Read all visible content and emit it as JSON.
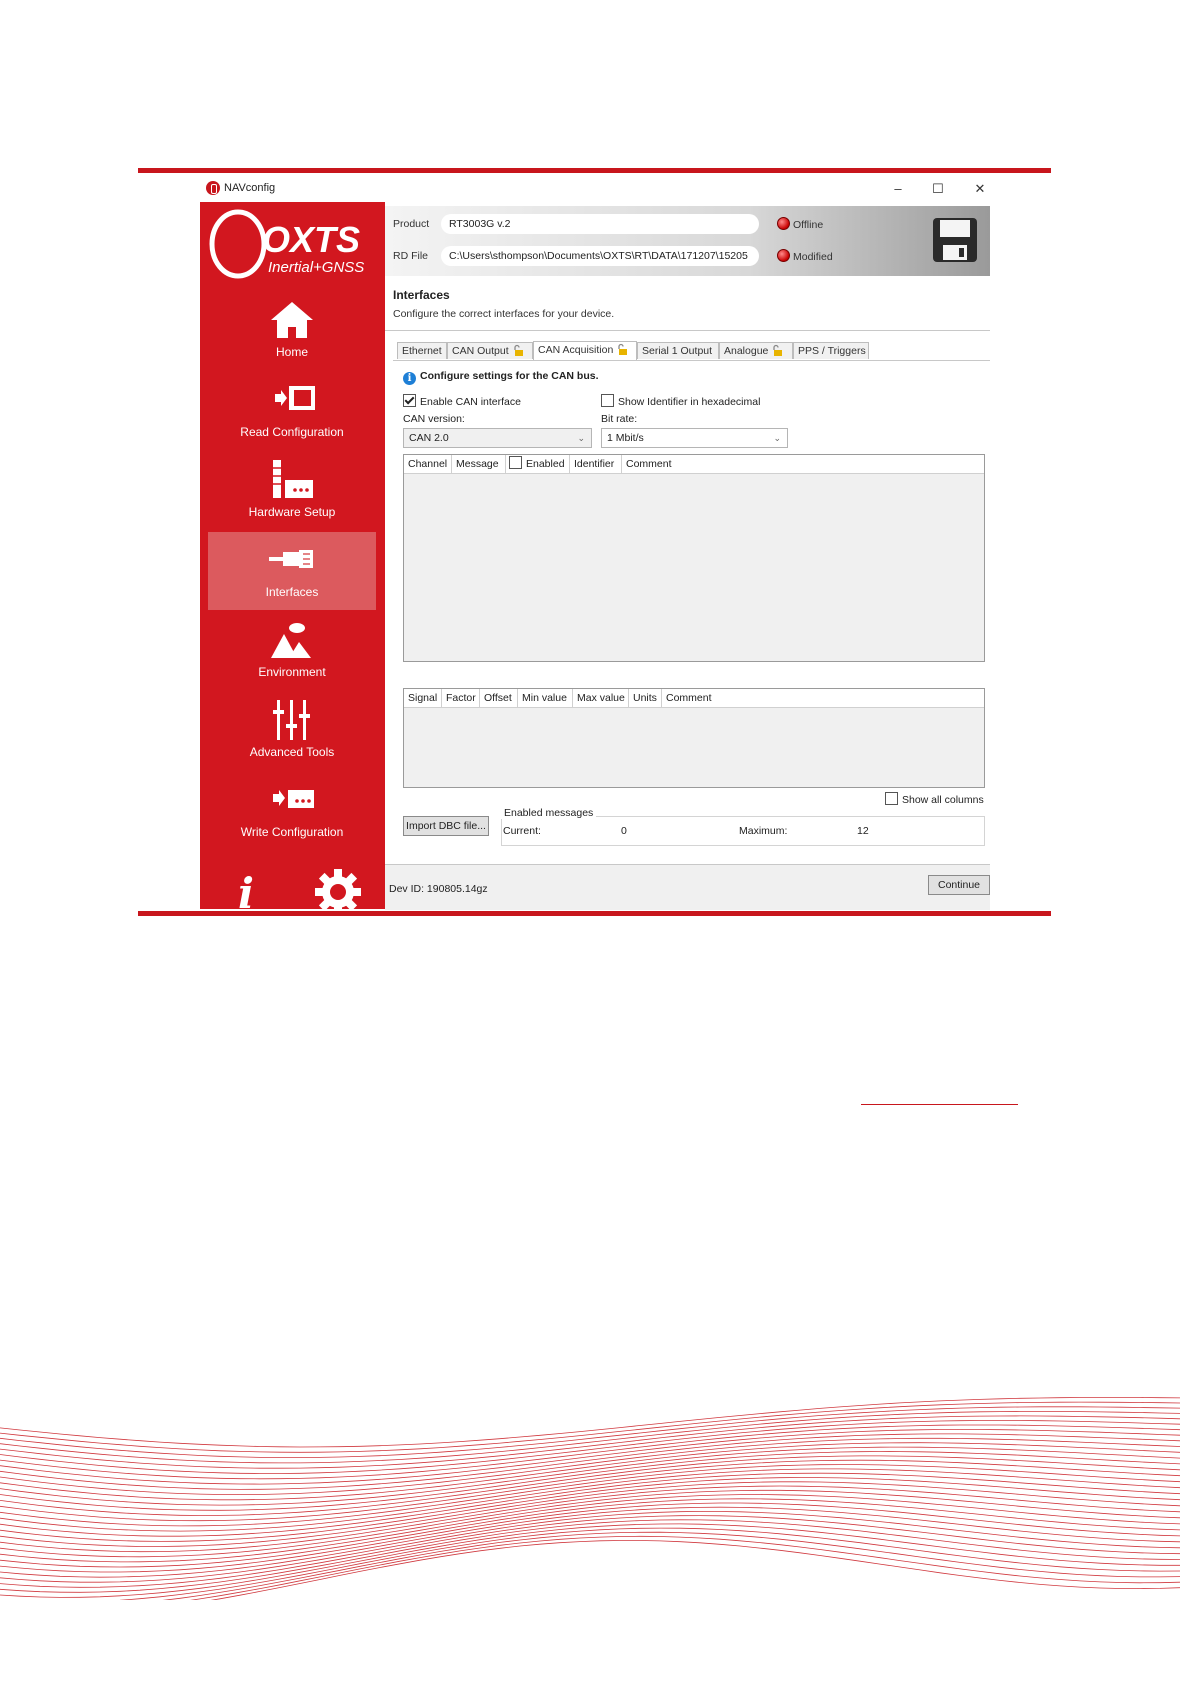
{
  "window": {
    "title": "NAVconfig",
    "controls": [
      "–",
      "☐",
      "✕"
    ]
  },
  "logo": {
    "brand": "OXTS",
    "tagline": "Inertial+GNSS"
  },
  "sidebar": {
    "items": [
      {
        "label": "Home",
        "icon": "home-icon"
      },
      {
        "label": "Read Configuration",
        "icon": "read-config-icon"
      },
      {
        "label": "Hardware Setup",
        "icon": "hardware-icon"
      },
      {
        "label": "Interfaces",
        "icon": "interfaces-icon",
        "active": true
      },
      {
        "label": "Environment",
        "icon": "environment-icon"
      },
      {
        "label": "Advanced Tools",
        "icon": "sliders-icon"
      },
      {
        "label": "Write Configuration",
        "icon": "write-config-icon"
      }
    ],
    "bottom": {
      "info_glyph": "i",
      "settings_icon": "gear-icon"
    }
  },
  "header": {
    "product_label": "Product",
    "product_value": "RT3003G v.2",
    "rd_label": "RD File",
    "rd_value": "C:\\Users\\sthompson\\Documents\\OXTS\\RT\\DATA\\171207\\15205",
    "status_offline": "Offline",
    "status_modified": "Modified"
  },
  "main": {
    "title": "Interfaces",
    "subtitle": "Configure the correct interfaces for your device.",
    "tabs": [
      {
        "label": "Ethernet"
      },
      {
        "label": "CAN Output",
        "locked": true
      },
      {
        "label": "CAN Acquisition",
        "locked": true,
        "active": true
      },
      {
        "label": "Serial 1 Output"
      },
      {
        "label": "Analogue",
        "locked": true
      },
      {
        "label": "PPS / Triggers"
      }
    ],
    "info_text": "Configure settings for the CAN bus.",
    "enable_can_label": "Enable CAN interface",
    "enable_can_checked": true,
    "show_hex_label": "Show Identifier in hexadecimal",
    "show_hex_checked": false,
    "can_version_label": "CAN version:",
    "can_version_value": "CAN 2.0",
    "bit_rate_label": "Bit rate:",
    "bit_rate_value": "1 Mbit/s",
    "channel_grid": {
      "columns": [
        "Channel",
        "Message",
        "Enabled",
        "Identifier",
        "Comment"
      ]
    },
    "signal_grid": {
      "columns": [
        "Signal",
        "Factor",
        "Offset",
        "Min value",
        "Max value",
        "Units",
        "Comment"
      ]
    },
    "show_all_columns_label": "Show all columns",
    "import_button": "Import DBC file...",
    "enabled_messages_label": "Enabled messages",
    "current_label": "Current:",
    "current_value": "0",
    "maximum_label": "Maximum:",
    "maximum_value": "12",
    "dev_id": "Dev ID: 190805.14gz",
    "continue_button": "Continue"
  },
  "colors": {
    "brand_red": "#d2171f",
    "active_nav": "#dc5a5e",
    "info_blue": "#1e7fd6"
  }
}
